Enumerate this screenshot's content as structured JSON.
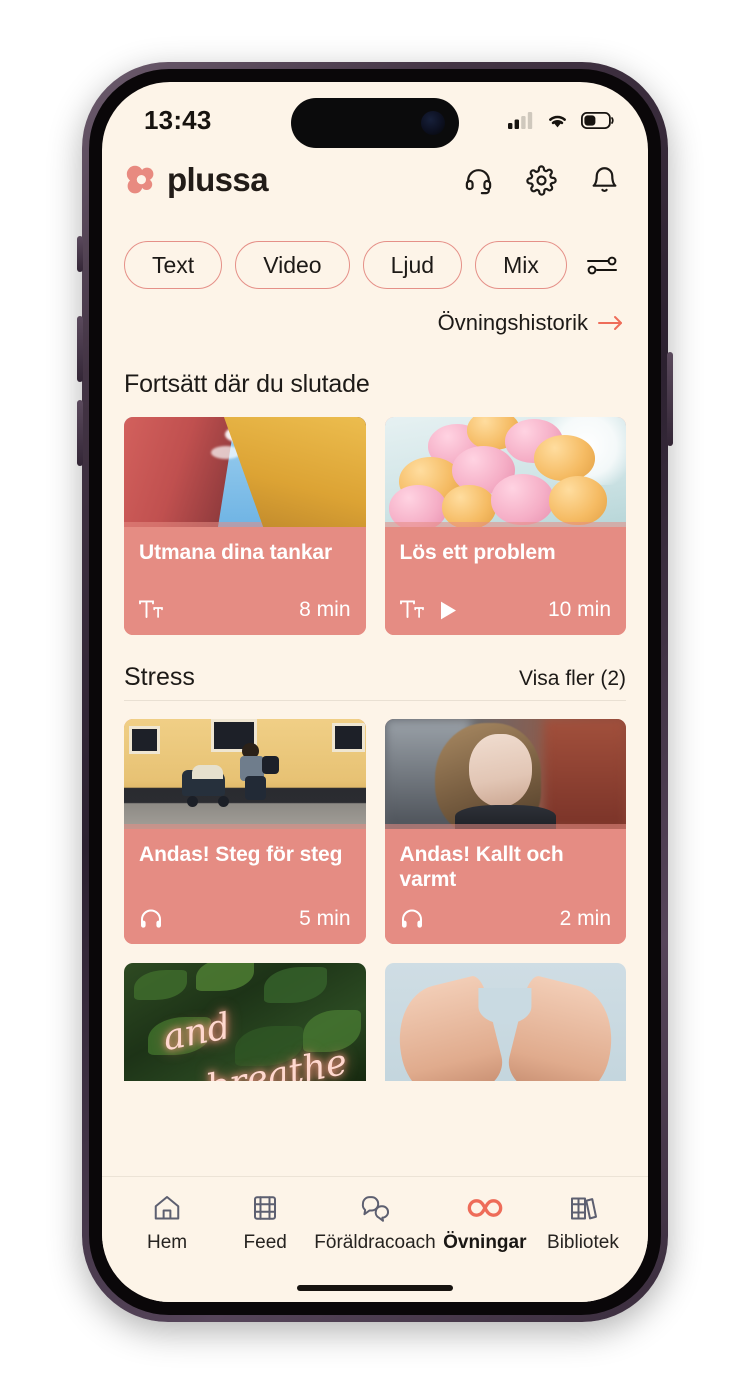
{
  "status_bar": {
    "time": "13:43",
    "signal_icon": "cellular-signal-icon",
    "wifi_icon": "wifi-icon",
    "battery_icon": "battery-icon",
    "battery_level_pct": 42
  },
  "header": {
    "brand_name": "plussa",
    "brand_logo_icon": "plussa-clover-logo",
    "actions": [
      {
        "name": "support-headset-icon",
        "label": "Support"
      },
      {
        "name": "settings-gear-icon",
        "label": "Inställningar"
      },
      {
        "name": "notifications-bell-icon",
        "label": "Notiser"
      }
    ]
  },
  "filters": {
    "chips": [
      {
        "label": "Text",
        "selected": false
      },
      {
        "label": "Video",
        "selected": false
      },
      {
        "label": "Ljud",
        "selected": false
      },
      {
        "label": "Mix",
        "selected": false
      }
    ],
    "settings_icon": "filter-sliders-icon"
  },
  "history": {
    "label": "Övningshistorik",
    "arrow_icon": "arrow-right-icon"
  },
  "sections": [
    {
      "title": "Fortsätt där du slutade",
      "show_more": null,
      "divider": false,
      "cards": [
        {
          "title": "Utmana dina tankar",
          "duration": "8 min",
          "media_icons": [
            "text-format-icon"
          ],
          "art": "architecture-sky"
        },
        {
          "title": "Lös ett problem",
          "duration": "10 min",
          "media_icons": [
            "text-format-icon",
            "play-icon"
          ],
          "art": "balloons"
        }
      ]
    },
    {
      "title": "Stress",
      "show_more": "Visa fler (2)",
      "divider": true,
      "cards": [
        {
          "title": "Andas! Steg för steg",
          "duration": "5 min",
          "media_icons": [
            "headphones-icon"
          ],
          "art": "street-stroller"
        },
        {
          "title": "Andas! Kallt och varmt",
          "duration": "2 min",
          "media_icons": [
            "headphones-icon"
          ],
          "art": "portrait-woman"
        }
      ]
    }
  ],
  "partial_cards": [
    {
      "art": "neon-breathe",
      "neon_line1": "and",
      "neon_line2": "breathe"
    },
    {
      "art": "heart-hands"
    }
  ],
  "bottom_nav": {
    "items": [
      {
        "label": "Hem",
        "icon": "home-icon",
        "active": false
      },
      {
        "label": "Feed",
        "icon": "film-strip-icon",
        "active": false
      },
      {
        "label": "Föräldracoach",
        "icon": "chat-bubbles-icon",
        "active": false
      },
      {
        "label": "Övningar",
        "icon": "infinity-icon",
        "active": true
      },
      {
        "label": "Bibliotek",
        "icon": "books-icon",
        "active": false
      }
    ]
  },
  "colors": {
    "background": "#fdf4e8",
    "accent": "#e58c83",
    "accent_strong": "#ee6c59",
    "text": "#1d1a17",
    "nav_icon": "#5d5f70",
    "divider": "#e9e0d3"
  }
}
